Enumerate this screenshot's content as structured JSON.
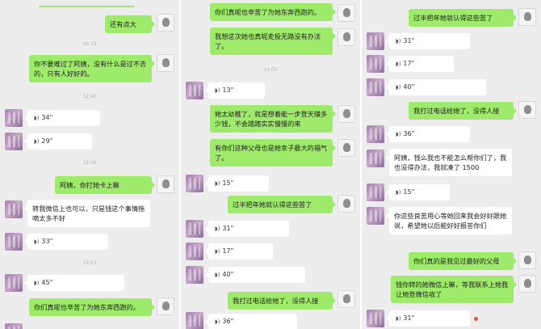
{
  "panels": [
    {
      "items": [
        {
          "kind": "text",
          "from": "me",
          "text": "还有点大"
        },
        {
          "kind": "time",
          "text": "00:19"
        },
        {
          "kind": "text",
          "from": "me",
          "text": "你不要难过了阿姨，没有什么是过不去的，只有人好好的。"
        },
        {
          "kind": "time",
          "text": "12:46"
        },
        {
          "kind": "voice",
          "from": "other",
          "text": "34\""
        },
        {
          "kind": "voice",
          "from": "other",
          "text": "29\""
        },
        {
          "kind": "time",
          "text": "12:56"
        },
        {
          "kind": "text",
          "from": "me",
          "text": "阿姨，你打她卡上嘛"
        },
        {
          "kind": "text",
          "from": "other",
          "text": "转我微信上也可以，只是钱这个事情拖嘀太多不好"
        },
        {
          "kind": "voice",
          "from": "other",
          "text": "33\""
        },
        {
          "kind": "time",
          "text": "13:03"
        },
        {
          "kind": "voice",
          "from": "other",
          "text": "45\""
        },
        {
          "kind": "text",
          "from": "me",
          "text": "你们真呢也辛苦了为她东奔西跑的。"
        }
      ]
    },
    {
      "items": [
        {
          "kind": "text",
          "from": "me",
          "text": "你们真呢也辛苦了为她东奔西跑的。"
        },
        {
          "kind": "text",
          "from": "me",
          "text": "我想这次她也真呢走投无路没有办法了。"
        },
        {
          "kind": "time",
          "text": "13:05"
        },
        {
          "kind": "voice",
          "from": "other",
          "text": "13\""
        },
        {
          "kind": "text",
          "from": "me",
          "text": "她太幼稚了，就是想着能一步登天赚多少钱，不会踏踏实实慢慢的来"
        },
        {
          "kind": "text",
          "from": "me",
          "text": "有你们这种父母也是她幸子最大的福气了。"
        },
        {
          "kind": "voice",
          "from": "other",
          "text": "15\""
        },
        {
          "kind": "text",
          "from": "me",
          "text": "过半把年她就认得这些苦了"
        },
        {
          "kind": "voice",
          "from": "other",
          "text": "31\""
        },
        {
          "kind": "voice",
          "from": "other",
          "text": "17\""
        },
        {
          "kind": "voice",
          "from": "other",
          "text": "40\""
        },
        {
          "kind": "text",
          "from": "me",
          "text": "我打过电话给她了，没得人接"
        },
        {
          "kind": "voice",
          "from": "other",
          "text": "36\""
        }
      ]
    },
    {
      "items": [
        {
          "kind": "text",
          "from": "me",
          "text": "过半把年她就认得这些苦了"
        },
        {
          "kind": "voice",
          "from": "other",
          "text": "31\""
        },
        {
          "kind": "voice",
          "from": "other",
          "text": "17\""
        },
        {
          "kind": "voice",
          "from": "other",
          "text": "40\""
        },
        {
          "kind": "text",
          "from": "me",
          "text": "我打过电话给她了，没得人接"
        },
        {
          "kind": "voice",
          "from": "other",
          "text": "36\""
        },
        {
          "kind": "text",
          "from": "me",
          "text": "阿姨，钱么我也不能怎么帮你们了，我也没得办法，我就凑了 1500"
        },
        {
          "kind": "voice",
          "from": "other",
          "text": "15\""
        },
        {
          "kind": "text",
          "from": "me",
          "text": "你这些良苦用心等她回来我会好好跟她说，希望她以后能好好报答你们"
        },
        {
          "kind": "text",
          "from": "me",
          "text": "你们真的是我见过最好的父母"
        },
        {
          "kind": "text",
          "from": "me",
          "text": "钱你转的她微信上嘛，等我联系上她我让她登微信收了"
        },
        {
          "kind": "voice",
          "from": "other",
          "text": "31\""
        }
      ]
    }
  ]
}
